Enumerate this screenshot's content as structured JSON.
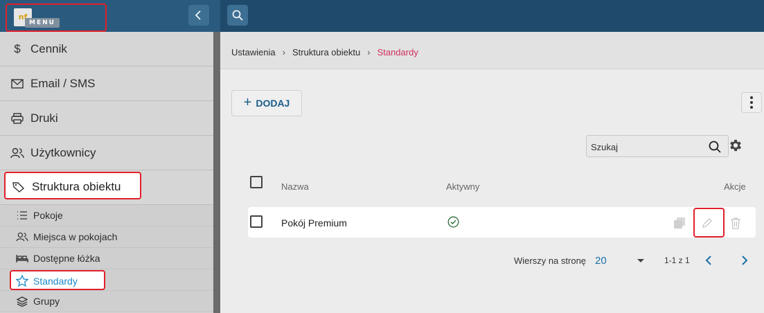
{
  "header": {
    "logo_text": "nf",
    "menu_label": "MENU",
    "collapse_icon": "chevron-left-icon",
    "search_icon": "search-icon"
  },
  "sidebar": {
    "items": [
      {
        "label": "Cennik",
        "icon": "dollar-icon"
      },
      {
        "label": "Email / SMS",
        "icon": "mail-icon"
      },
      {
        "label": "Druki",
        "icon": "printer-icon"
      },
      {
        "label": "Użytkownicy",
        "icon": "users-icon"
      },
      {
        "label": "Struktura obiektu",
        "icon": "tag-icon",
        "active": true
      }
    ],
    "subitems": [
      {
        "label": "Pokoje",
        "icon": "list-icon"
      },
      {
        "label": "Miejsca w pokojach",
        "icon": "users-icon"
      },
      {
        "label": "Dostępne łóżka",
        "icon": "bed-icon"
      },
      {
        "label": "Standardy",
        "icon": "star-icon",
        "active": true
      },
      {
        "label": "Grupy",
        "icon": "layers-icon"
      }
    ]
  },
  "breadcrumb": [
    "Ustawienia",
    "Struktura obiektu",
    "Standardy"
  ],
  "toolbar": {
    "add_label": "DODAJ",
    "more_icon": "kebab-icon"
  },
  "search": {
    "placeholder": "Szukaj",
    "settings_icon": "gear-icon"
  },
  "table": {
    "columns": [
      "Nazwa",
      "Aktywny",
      "Akcje"
    ],
    "rows": [
      {
        "name": "Pokój Premium",
        "active": true
      }
    ]
  },
  "pagination": {
    "rows_per_page_label": "Wierszy na stronę",
    "rows_per_page_value": "20",
    "range_text": "1-1 z 1"
  },
  "colors": {
    "topbar": "#1f4a6b",
    "highlight": "#e0202a",
    "breadcrumb_current": "#d0305e",
    "accent_blue": "#1a87c9",
    "active_check": "#2e8b3d"
  }
}
